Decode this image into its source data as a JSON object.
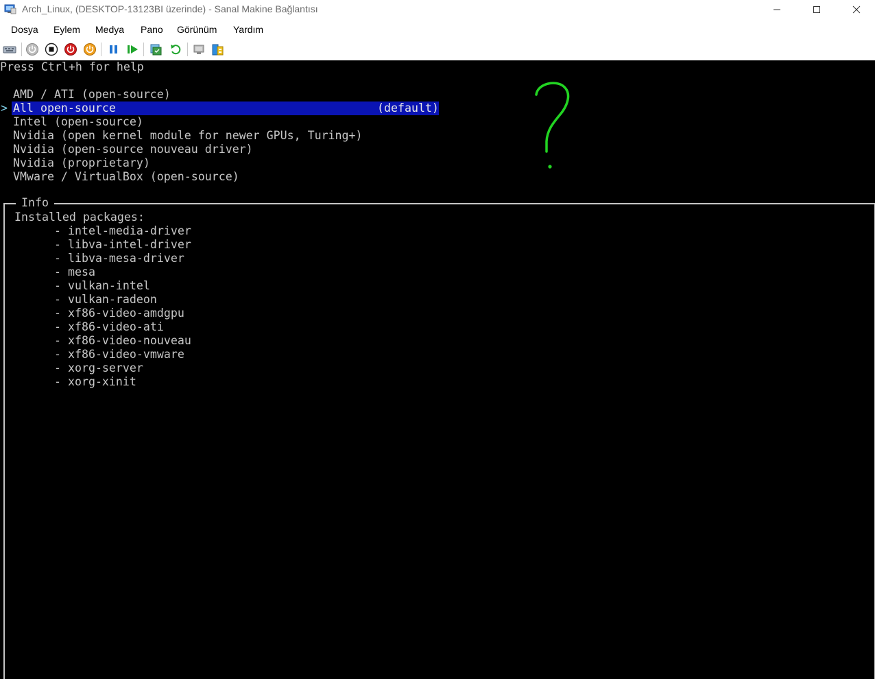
{
  "window": {
    "title": "Arch_Linux, (DESKTOP-13123BI üzerinde) - Sanal Makine Bağlantısı"
  },
  "menu": {
    "items": [
      "Dosya",
      "Eylem",
      "Medya",
      "Pano",
      "Görünüm",
      "Yardım"
    ]
  },
  "toolbar": {
    "buttons": [
      {
        "icon": "ctrl-alt-del-icon"
      },
      {
        "icon": "start-icon",
        "color": "#9a9a9a"
      },
      {
        "icon": "turn-off-icon",
        "color": "#000000"
      },
      {
        "icon": "shut-down-icon",
        "color": "#d21f1f"
      },
      {
        "icon": "save-icon",
        "color": "#e8900a"
      },
      {
        "icon": "pause-icon",
        "color": "#1e73d2"
      },
      {
        "icon": "resume-icon",
        "color": "#1fa52c"
      },
      {
        "icon": "checkpoint-icon"
      },
      {
        "icon": "revert-icon",
        "color": "#1fa52c"
      },
      {
        "icon": "enhanced-session-icon"
      },
      {
        "icon": "share-icon"
      }
    ]
  },
  "console": {
    "help_text": "Press Ctrl+h for help",
    "cursor": ">",
    "options": [
      "AMD / ATI (open-source)",
      "All open-source",
      "Intel (open-source)",
      "Nvidia (open kernel module for newer GPUs, Turing+)",
      "Nvidia (open-source nouveau driver)",
      "Nvidia (proprietary)",
      "VMware / VirtualBox (open-source)"
    ],
    "selected_index": 1,
    "default_tag": "(default)",
    "highlight_color": "#0a14b4",
    "info": {
      "title": "Info",
      "installed_label": "Installed packages:",
      "packages": [
        "- intel-media-driver",
        "- libva-intel-driver",
        "- libva-mesa-driver",
        "- mesa",
        "- vulkan-intel",
        "- vulkan-radeon",
        "- xf86-video-amdgpu",
        "- xf86-video-ati",
        "- xf86-video-nouveau",
        "- xf86-video-vmware",
        "- xorg-server",
        "- xorg-xinit"
      ]
    }
  },
  "annotation": {
    "glyph": "?",
    "color": "#22d422"
  }
}
